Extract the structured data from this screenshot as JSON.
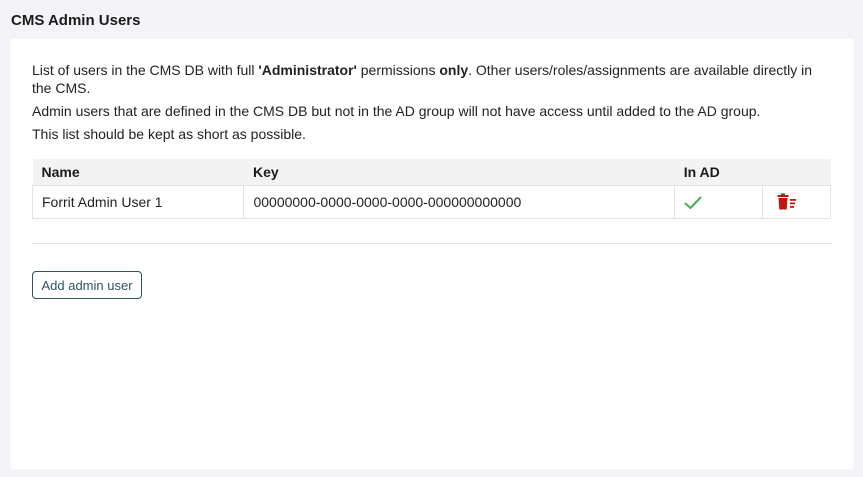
{
  "page": {
    "title": "CMS Admin Users"
  },
  "description": {
    "line1_prefix": "List of users in the CMS DB with full ",
    "line1_strong": "'Administrator'",
    "line1_middle": " permissions ",
    "line1_only": "only",
    "line1_suffix": ". Other users/roles/assignments are available directly in the CMS.",
    "line2": "Admin users that are defined in the CMS DB but not in the AD group will not have access until added to the AD group.",
    "line3": "This list should be kept as short as possible."
  },
  "table": {
    "columns": {
      "name": "Name",
      "key": "Key",
      "in_ad": "In AD"
    },
    "rows": [
      {
        "name": "Forrit Admin User 1",
        "key": "00000000-0000-0000-0000-000000000000",
        "in_ad": true
      }
    ]
  },
  "actions": {
    "add_label": "Add admin user"
  },
  "icons": {
    "check": "check-icon",
    "delete": "trash-icon"
  },
  "colors": {
    "check": "#4caf50",
    "delete": "#c0160e",
    "button_accent": "#2f5460",
    "background": "#f4f4f8"
  }
}
